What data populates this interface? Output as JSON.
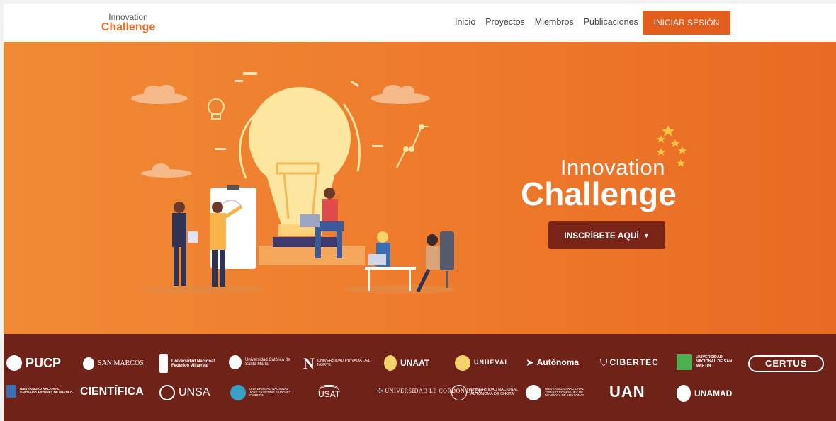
{
  "navbar": {
    "logo": {
      "top": "Innovation",
      "bottom": "Challenge"
    },
    "links": [
      "Inicio",
      "Proyectos",
      "Miembros",
      "Publicaciones"
    ],
    "login_label": "INICIAR SESIÓN"
  },
  "hero": {
    "brand_top": "Innovation",
    "brand_bottom": "Challenge",
    "cta_label": "INSCRÍBETE AQUÍ"
  },
  "partners": {
    "row1": [
      "PUCP",
      "SAN MARCOS",
      "Universidad Nacional Federico Villarreal",
      "Universidad Católica de Santa María",
      "UNIVERSIDAD PRIVADA DEL NORTE",
      "UNAAT",
      "UNHEVAL",
      "Autónoma",
      "CIBERTEC",
      "UNIVERSIDAD NACIONAL DE SAN MARTIN",
      "CERTUS"
    ],
    "row2": [
      "UNIVERSIDAD NACIONAL SANTIAGO ANTÚNEZ DE MAYOLO",
      "CIENTÍFICA",
      "UNSA",
      "UNIVERSIDAD NACIONAL JOSÉ FAUSTINO SÁNCHEZ CARRIÓN",
      "USAT",
      "UNIVERSIDAD LE CORDON BLEU",
      "UNIVERSIDAD NACIONAL AUTÓNOMA DE CHOTA",
      "UNIVERSIDAD NACIONAL TORIBIO RODRÍGUEZ DE MENDOZA DE AMAZONAS",
      "UAN",
      "UNAMAD"
    ]
  },
  "colors": {
    "accent": "#e35d1c",
    "hero_orange": "#ee7a2b",
    "cta_dark": "#7a2418",
    "footer_band": "#6f2218",
    "bulb_yellow": "#fde6a0"
  }
}
